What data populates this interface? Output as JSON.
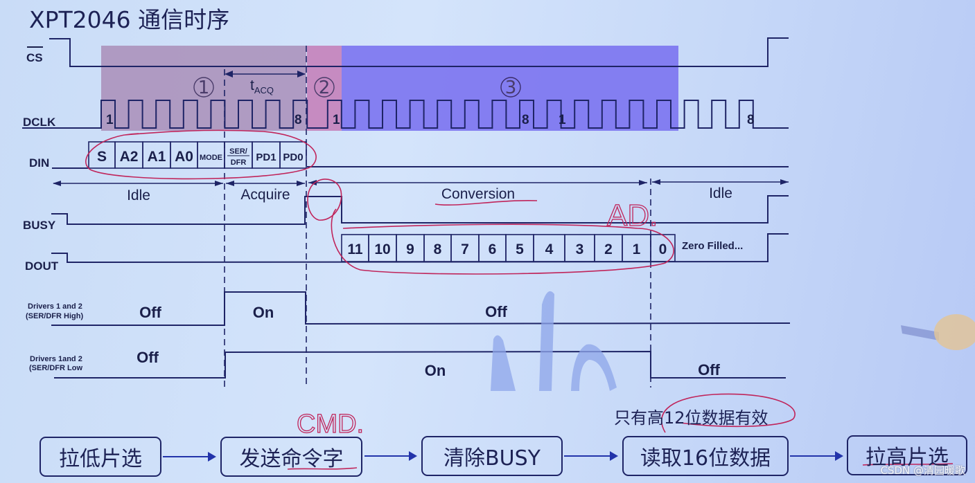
{
  "title": "XPT2046 通信时序",
  "signals": {
    "cs": "CS",
    "dclk": "DCLK",
    "din": "DIN",
    "busy": "BUSY",
    "dout": "DOUT",
    "drivers_high": {
      "line1": "Drivers 1 and 2",
      "line2": "(SER/DFR High)"
    },
    "drivers_low": {
      "line1": "Drivers 1and 2",
      "line2": "(SER/DFR Low"
    }
  },
  "regions": {
    "r1": "①",
    "r2": "②",
    "r3": "③",
    "tacq_main": "t",
    "tacq_sub": "ACQ"
  },
  "clock_labels": {
    "first_start": "1",
    "first_end": "8",
    "second_start": "1",
    "second_end": "8",
    "third_start": "1",
    "third_end": "8"
  },
  "din_bits": [
    "S",
    "A2",
    "A1",
    "A0",
    "MODE",
    "SER/",
    "DFR",
    "PD1",
    "PD0"
  ],
  "phases": {
    "idle1": "Idle",
    "acquire": "Acquire",
    "conversion": "Conversion",
    "idle2": "Idle"
  },
  "dout_bits": [
    "11",
    "10",
    "9",
    "8",
    "7",
    "6",
    "5",
    "4",
    "3",
    "2",
    "1",
    "0"
  ],
  "dout_tail": "Zero Filled...",
  "driver_states": {
    "high": [
      "Off",
      "On",
      "Off"
    ],
    "low": [
      "Off",
      "On",
      "Off"
    ]
  },
  "annotations": {
    "ad": "AD.",
    "cmd": "CMD."
  },
  "note": "只有高12位数据有效",
  "flow": [
    "拉低片选",
    "发送命令字",
    "清除BUSY",
    "读取16位数据",
    "拉高片选"
  ],
  "colors": {
    "region1": "#a98eb8",
    "region2": "#c47bb6",
    "region3": "#7b73ef",
    "line": "#1e2466",
    "ink": "#c0245a"
  },
  "watermark": "CSDN @清园暖歌"
}
